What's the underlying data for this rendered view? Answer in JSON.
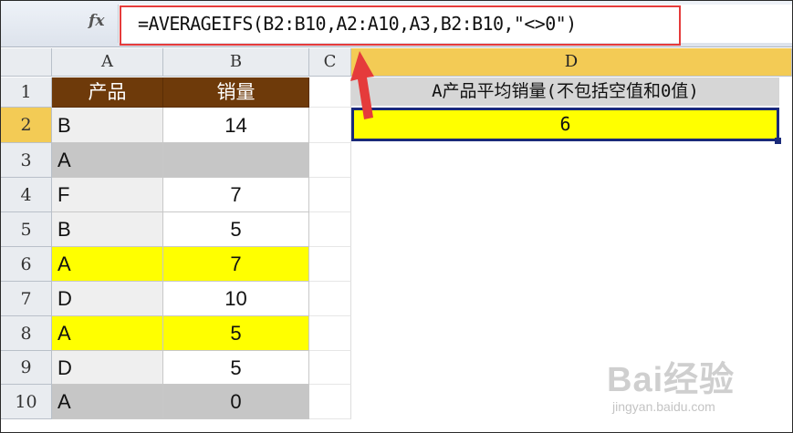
{
  "formula_bar": {
    "fx_label": "fx",
    "formula": "=AVERAGEIFS(B2:B10,A2:A10,A3,B2:B10,\"<>0\")"
  },
  "column_headers": [
    "A",
    "B",
    "C",
    "D"
  ],
  "selected_column": "D",
  "row_headers": [
    "1",
    "2",
    "3",
    "4",
    "5",
    "6",
    "7",
    "8",
    "9",
    "10"
  ],
  "selected_row": "2",
  "table": {
    "header": {
      "product": "产品",
      "sales": "销量"
    },
    "rows": [
      {
        "product": "B",
        "sales": "14",
        "highlight": "none"
      },
      {
        "product": "A",
        "sales": "",
        "highlight": "grey"
      },
      {
        "product": "F",
        "sales": "7",
        "highlight": "none"
      },
      {
        "product": "B",
        "sales": "5",
        "highlight": "none"
      },
      {
        "product": "A",
        "sales": "7",
        "highlight": "yellow"
      },
      {
        "product": "D",
        "sales": "10",
        "highlight": "none"
      },
      {
        "product": "A",
        "sales": "5",
        "highlight": "yellow"
      },
      {
        "product": "D",
        "sales": "5",
        "highlight": "none"
      },
      {
        "product": "A",
        "sales": "0",
        "highlight": "grey"
      }
    ]
  },
  "d_column": {
    "d1": "A产品平均销量(不包括空值和0值)",
    "d2": "6"
  },
  "watermark": {
    "logo": "Bai经验",
    "url": "jingyan.baidu.com"
  },
  "colors": {
    "header_brown": "#6e3a0a",
    "highlight_yellow": "#ffff00",
    "highlight_grey": "#c6c6c6",
    "annotation_red": "#e53b3b",
    "selection_border": "#1a2a7a"
  }
}
